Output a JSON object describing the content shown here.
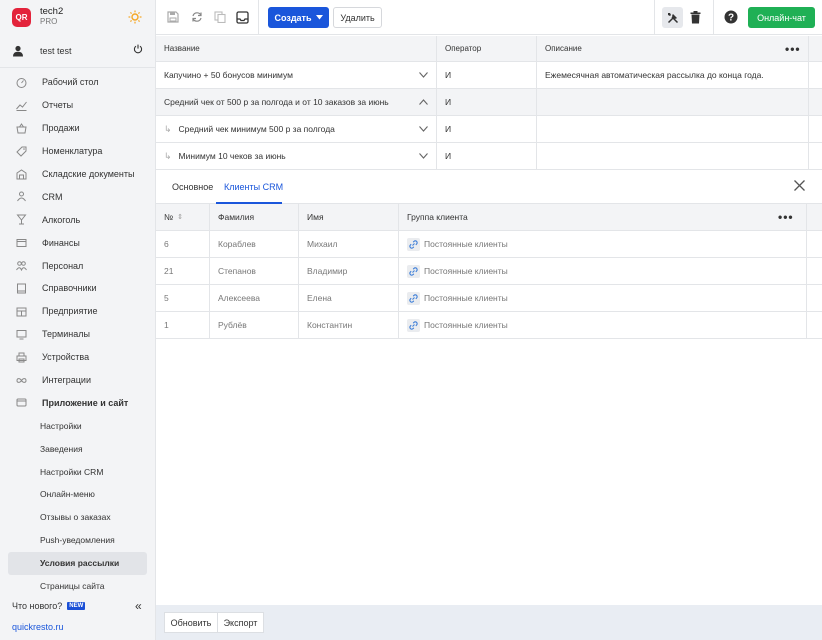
{
  "brand": {
    "logo": "QR",
    "name": "tech2",
    "plan": "PRO"
  },
  "user": {
    "name": "test test"
  },
  "nav": [
    {
      "label": "Рабочий стол",
      "icon": "dashboard-icon"
    },
    {
      "label": "Отчеты",
      "icon": "reports-icon"
    },
    {
      "label": "Продажи",
      "icon": "basket-icon"
    },
    {
      "label": "Номенклатура",
      "icon": "tag-icon"
    },
    {
      "label": "Складские документы",
      "icon": "warehouse-icon"
    },
    {
      "label": "CRM",
      "icon": "crm-icon"
    },
    {
      "label": "Алкоголь",
      "icon": "glass-icon"
    },
    {
      "label": "Финансы",
      "icon": "wallet-icon"
    },
    {
      "label": "Персонал",
      "icon": "staff-icon"
    },
    {
      "label": "Справочники",
      "icon": "book-icon"
    },
    {
      "label": "Предприятие",
      "icon": "enterprise-icon"
    },
    {
      "label": "Терминалы",
      "icon": "terminal-icon"
    },
    {
      "label": "Устройства",
      "icon": "printer-icon"
    },
    {
      "label": "Интеграции",
      "icon": "infinity-icon"
    },
    {
      "label": "Приложение и сайт",
      "icon": "app-icon"
    }
  ],
  "subnav": [
    "Настройки",
    "Заведения",
    "Настройки CRM",
    "Онлайн-меню",
    "Отзывы о заказах",
    "Push-уведомления",
    "Условия рассылки",
    "Страницы сайта"
  ],
  "subnav_active": "Условия рассылки",
  "sidebar_footer": {
    "whatsnew": "Что нового?",
    "new_badge": "NEW",
    "site_link": "quickresto.ru"
  },
  "toolbar": {
    "create": "Создать",
    "delete": "Удалить",
    "chat": "Онлайн-чат"
  },
  "conditions": {
    "columns": [
      "Название",
      "Оператор",
      "Описание"
    ],
    "rows": [
      {
        "name": "Капучино + 50 бонусов минимум",
        "operator": "И",
        "description": "Ежемесячная автоматическая рассылка до конца года."
      },
      {
        "name": "Средний чек от 500 р за полгода и от 10 заказов за июнь",
        "operator": "И",
        "description": ""
      },
      {
        "name": "Средний чек минимум 500 р за полгода",
        "operator": "И",
        "description": ""
      },
      {
        "name": "Минимум 10 чеков за июнь",
        "operator": "И",
        "description": ""
      }
    ]
  },
  "detail": {
    "tabs": [
      "Основное",
      "Клиенты CRM"
    ],
    "active_tab": "Клиенты CRM",
    "columns": [
      "№",
      "Фамилия",
      "Имя",
      "Группа клиента"
    ],
    "rows": [
      {
        "num": "6",
        "surname": "Кораблев",
        "name": "Михаил",
        "group": "Постоянные клиенты"
      },
      {
        "num": "21",
        "surname": "Степанов",
        "name": "Владимир",
        "group": "Постоянные клиенты"
      },
      {
        "num": "5",
        "surname": "Алексеева",
        "name": "Елена",
        "group": "Постоянные клиенты"
      },
      {
        "num": "1",
        "surname": "Рублёв",
        "name": "Константин",
        "group": "Постоянные клиенты"
      }
    ]
  },
  "footer": {
    "refresh": "Обновить",
    "export": "Экспорт"
  },
  "colors": {
    "accent": "#1a56db",
    "chat": "#1fb055",
    "logo": "#e3233b"
  }
}
